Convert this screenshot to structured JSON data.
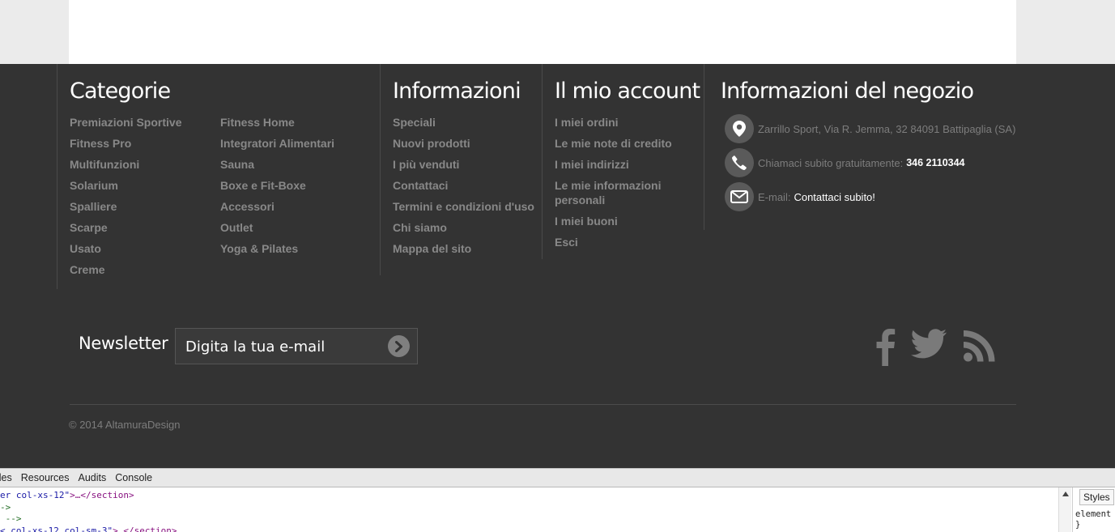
{
  "footer": {
    "categories": {
      "title": "Categorie",
      "col1": [
        "Premiazioni Sportive",
        "Fitness Pro",
        "Multifunzioni",
        "Solarium",
        "Spalliere",
        "Scarpe",
        "Usato",
        "Creme"
      ],
      "col2": [
        "Fitness Home",
        "Integratori Alimentari",
        "Sauna",
        "Boxe e Fit-Boxe",
        "Accessori",
        "Outlet",
        "Yoga & Pilates"
      ]
    },
    "information": {
      "title": "Informazioni",
      "items": [
        "Speciali",
        "Nuovi prodotti",
        "I più venduti",
        "Contattaci",
        "Termini e condizioni d'uso",
        "Chi siamo",
        "Mappa del sito"
      ]
    },
    "account": {
      "title": "Il mio account",
      "items": [
        "I miei ordini",
        "Le mie note di credito",
        "I miei indirizzi",
        "Le mie informazioni personali",
        "I miei buoni",
        "Esci"
      ]
    },
    "store": {
      "title": "Informazioni del negozio",
      "address": "Zarrillo Sport, Via R. Jemma, 32 84091 Battipaglia (SA)",
      "phone_label": "Chiamaci subito gratuitamente:",
      "phone": "346 2110344",
      "email_label": "E-mail:",
      "email_link": "Contattaci subito!"
    },
    "newsletter": {
      "label": "Newsletter",
      "placeholder": "Digita la tua e-mail"
    },
    "social": [
      "facebook-icon",
      "twitter-icon",
      "rss-icon"
    ],
    "copyright": "© 2014 AltamuraDesign"
  },
  "devtools": {
    "tabs": [
      "iles",
      "Resources",
      "Audits",
      "Console"
    ],
    "code_lines": [
      {
        "a": "er col-xs-12\"",
        "b": ">…</section>"
      },
      {
        "c": "->"
      },
      {
        "c": " -->"
      },
      {
        "a": "< col-xs-12 col-sm-3\"",
        "b": "> </section>"
      }
    ],
    "styles_label": "Styles",
    "side_code": [
      "element",
      "}"
    ]
  },
  "colors": {
    "footer_bg": "#333333",
    "link_gray": "#888888",
    "heading": "#ffffff",
    "icon_circle": "#5a5a5a"
  }
}
